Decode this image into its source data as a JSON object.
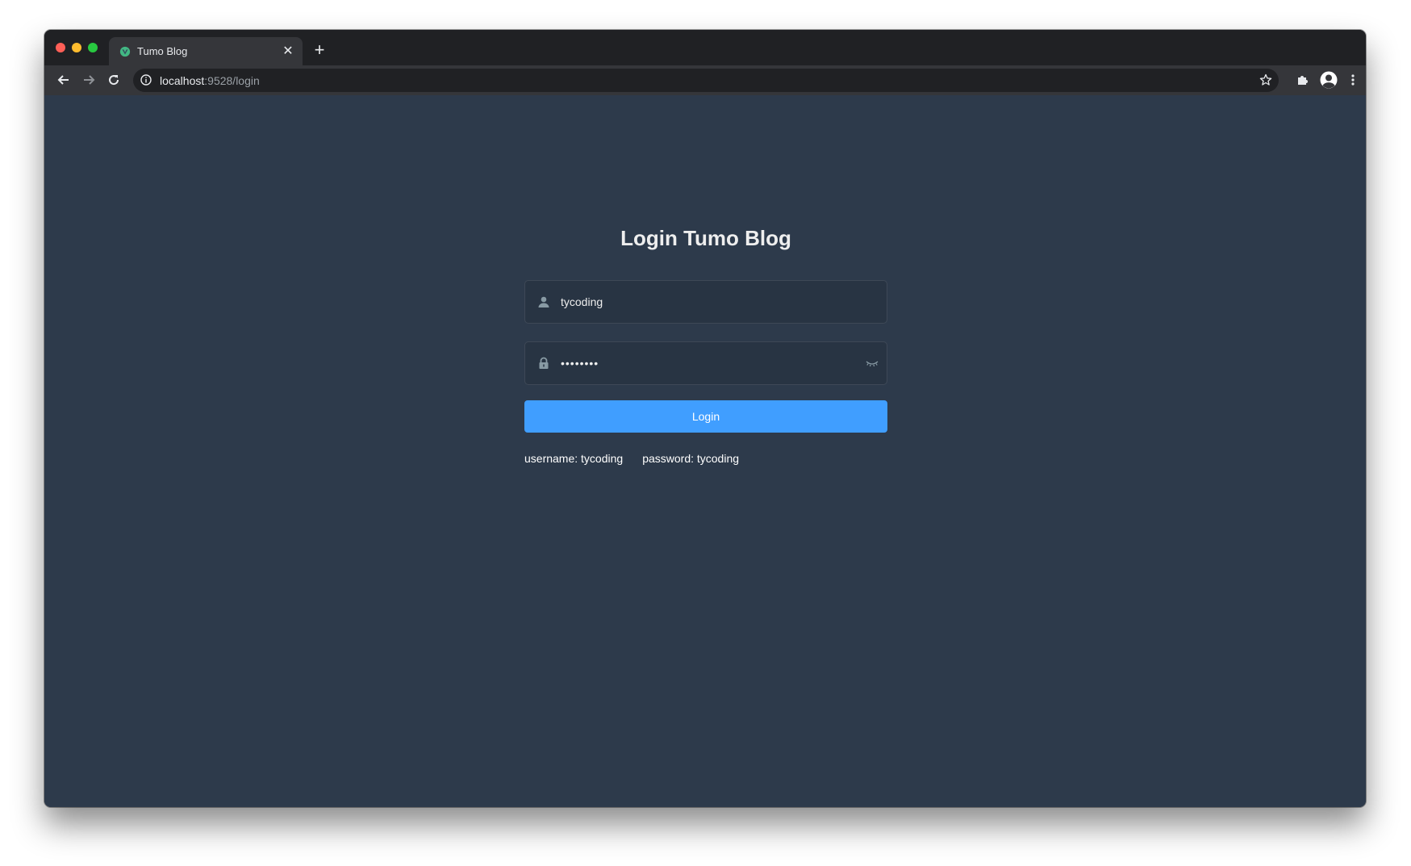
{
  "browser": {
    "tab": {
      "title": "Tumo Blog",
      "favicon": "vue-logo-icon",
      "close_icon": "close-icon"
    },
    "new_tab_icon": "plus-icon",
    "nav": {
      "back_icon": "arrow-left-icon",
      "forward_icon": "arrow-right-icon",
      "reload_icon": "reload-icon"
    },
    "omnibox": {
      "info_icon": "info-icon",
      "host": "localhost",
      "path": ":9528/login",
      "star_icon": "star-icon"
    },
    "extensions_icon": "puzzle-icon",
    "profile_icon": "avatar-icon",
    "menu_icon": "kebab-menu-icon"
  },
  "login": {
    "title": "Login Tumo Blog",
    "username": {
      "icon": "user-icon",
      "value": "tycoding"
    },
    "password": {
      "icon": "lock-icon",
      "value": "••••••••",
      "toggle_icon": "eye-closed-icon"
    },
    "button_label": "Login",
    "tips": {
      "username": "username: tycoding",
      "password": "password: tycoding"
    }
  },
  "colors": {
    "background": "#2d3a4b",
    "primary": "#409eff",
    "text": "#eeeeee",
    "chrome_dark": "#202124",
    "chrome_tab": "#35363a"
  }
}
